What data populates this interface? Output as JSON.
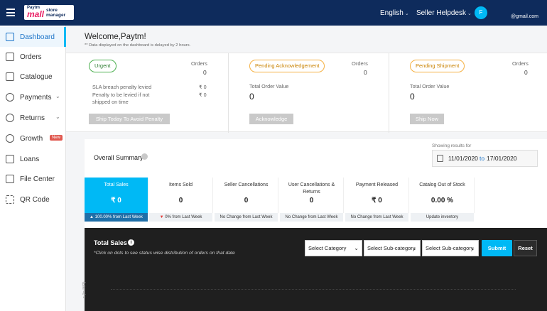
{
  "header": {
    "logo_top": "Paytm",
    "logo_main": "mall",
    "logo_sub": "store manager",
    "language": "English",
    "helpdesk": "Seller Helpdesk",
    "avatar_initial": "F",
    "user_name": "",
    "user_email": "@gmail.com"
  },
  "sidebar": {
    "items": [
      {
        "label": "Dashboard",
        "icon": "dashboard-icon",
        "active": true
      },
      {
        "label": "Orders",
        "icon": "orders-icon"
      },
      {
        "label": "Catalogue",
        "icon": "catalogue-icon"
      },
      {
        "label": "Payments",
        "icon": "payments-icon",
        "expandable": true
      },
      {
        "label": "Returns",
        "icon": "returns-icon",
        "expandable": true
      },
      {
        "label": "Growth",
        "icon": "growth-icon",
        "badge": "New"
      },
      {
        "label": "Loans",
        "icon": "loans-icon"
      },
      {
        "label": "File Center",
        "icon": "file-center-icon"
      },
      {
        "label": "QR Code",
        "icon": "qr-code-icon"
      }
    ]
  },
  "main": {
    "welcome": "Welcome,Paytm!",
    "note": "** Data displayed on the dashboard is delayed by 2 hours."
  },
  "cards": {
    "urgent": {
      "pill": "Urgent",
      "orders_label": "Orders",
      "orders_value": "0",
      "sla_label": "SLA breach penalty levied",
      "sla_value": "₹ 0",
      "penalty_label": "Penalty to be levied if not shipped on time",
      "penalty_value": "₹ 0",
      "button": "Ship Today To Avoid Penalty"
    },
    "ack": {
      "pill": "Pending Acknowledgement",
      "orders_label": "Orders",
      "orders_value": "0",
      "total_label": "Total Order Value",
      "total_value": "0",
      "button": "Acknowledge"
    },
    "shipment": {
      "pill": "Pending Shipment",
      "orders_label": "Orders",
      "orders_value": "0",
      "total_label": "Total Order Value",
      "total_value": "0",
      "button": "Ship Now"
    }
  },
  "summary": {
    "title": "Overall Summary",
    "showing_label": "Showing results for",
    "date_from": "11/01/2020",
    "date_to_word": "to",
    "date_to": "17/01/2020",
    "stats": [
      {
        "label": "Total Sales",
        "value": "₹ 0",
        "foot": "100.00%  from Last  Week",
        "trend": "up"
      },
      {
        "label": "Items Sold",
        "value": "0",
        "foot": "0%  from Last  Week",
        "trend": "down"
      },
      {
        "label": "Seller Cancellations",
        "value": "0",
        "foot": "No Change  from Last  Week"
      },
      {
        "label": "User Cancellations & Returns",
        "value": "0",
        "foot": "No Change  from Last  Week"
      },
      {
        "label": "Payment Released",
        "value": "₹ 0",
        "foot": "No Change  from Last  Week"
      },
      {
        "label": "Catalog Out of Stock",
        "value": "0.00 %",
        "foot": "Update inventory"
      }
    ]
  },
  "sales_panel": {
    "title": "Total Sales",
    "note": "*Click on dots to see status wise distribution of orders on that date",
    "select_category": "Select Category",
    "select_subcategory_1": "Select Sub-category",
    "select_subcategory_2": "Select Sub-category",
    "submit": "Submit",
    "reset": "Reset",
    "y_axis_label": "s (In INR)"
  },
  "colors": {
    "header_bg": "#0e2b5c",
    "accent": "#00b9f5",
    "dark_panel": "#1f1f1f"
  }
}
